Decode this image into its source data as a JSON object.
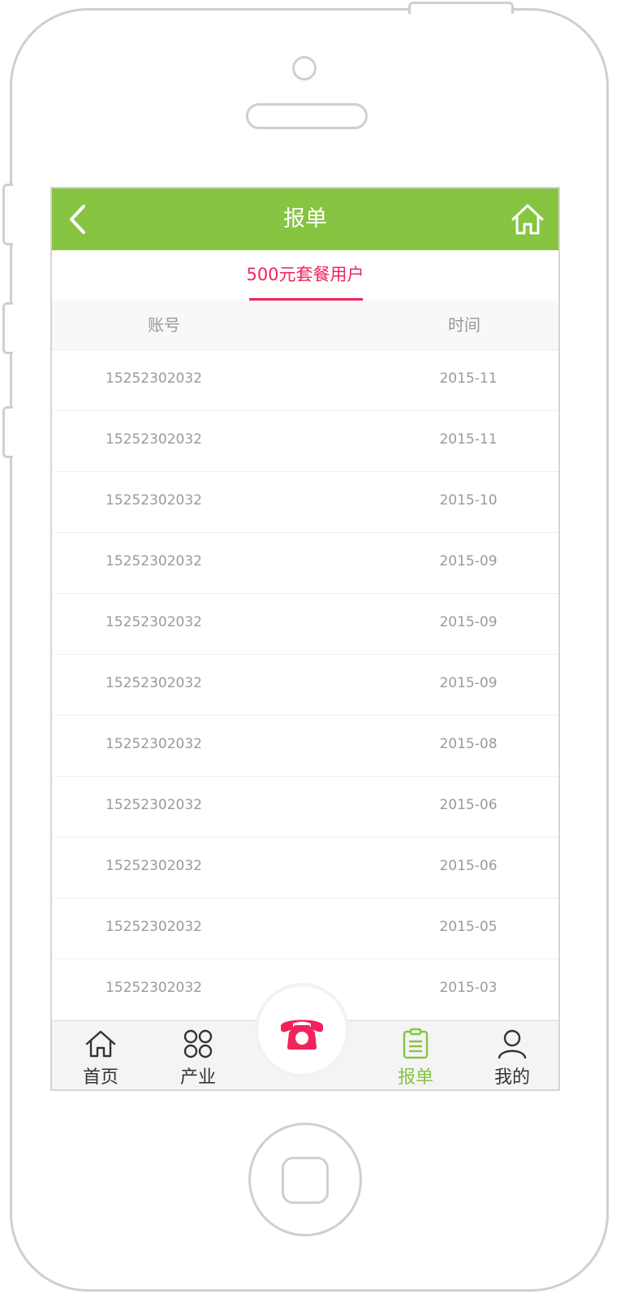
{
  "header": {
    "title": "报单"
  },
  "tabs": {
    "active_label": "500元套餐用户"
  },
  "table": {
    "columns": [
      "账号",
      "时间"
    ],
    "rows": [
      [
        "15252302032",
        "2015-11"
      ],
      [
        "15252302032",
        "2015-11"
      ],
      [
        "15252302032",
        "2015-10"
      ],
      [
        "15252302032",
        "2015-09"
      ],
      [
        "15252302032",
        "2015-09"
      ],
      [
        "15252302032",
        "2015-09"
      ],
      [
        "15252302032",
        "2015-08"
      ],
      [
        "15252302032",
        "2015-06"
      ],
      [
        "15252302032",
        "2015-06"
      ],
      [
        "15252302032",
        "2015-05"
      ],
      [
        "15252302032",
        "2015-03"
      ]
    ]
  },
  "bottom_nav": {
    "items": [
      {
        "label": "首页",
        "icon": "home-icon"
      },
      {
        "label": "产业",
        "icon": "grid-icon"
      },
      {
        "label": "报单",
        "icon": "clipboard-icon",
        "active": true
      },
      {
        "label": "我的",
        "icon": "user-icon"
      }
    ],
    "center_icon": "phone-icon"
  },
  "colors": {
    "brand_green": "#87c442",
    "accent_pink": "#f0245b"
  }
}
